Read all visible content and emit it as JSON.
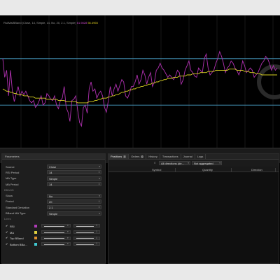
{
  "chart": {
    "indicator_title": "Rsi/Ma/BBand (Close, 14, Simple, 14, No, 20, 2.1, Simple)",
    "indicator_value_1": "61.9828",
    "indicator_value_2": "56.4965",
    "series": [
      {
        "name": "RSI",
        "color": "#b030b0"
      },
      {
        "name": "MA",
        "color": "#d8d020"
      }
    ],
    "ylim": [
      0,
      100
    ],
    "overbought_level": 70,
    "oversold_level": 30,
    "rsi_values": [
      70,
      54,
      60,
      38,
      60,
      42,
      33,
      40,
      46,
      38,
      42,
      39,
      42,
      38,
      34,
      32,
      34,
      28,
      30,
      34,
      38,
      30,
      32,
      40,
      38,
      35,
      34,
      38,
      30,
      27,
      34,
      36,
      46,
      28,
      24,
      16,
      34,
      35,
      38,
      26,
      15,
      12,
      28,
      30,
      23,
      44,
      50,
      42,
      44,
      36,
      40,
      42,
      38,
      28,
      24,
      34,
      46,
      38,
      44,
      48,
      42,
      47,
      52,
      50,
      38,
      36,
      40,
      46,
      46,
      50,
      56,
      48,
      52,
      60,
      56,
      48,
      54,
      58,
      46,
      50,
      60,
      62,
      66,
      62,
      60,
      57,
      54,
      56,
      54,
      52,
      55,
      60,
      58,
      48,
      52,
      60,
      64,
      68,
      60,
      58,
      55,
      54,
      62,
      60,
      58,
      70,
      74,
      62,
      56,
      58,
      60,
      66,
      70,
      76,
      72,
      66,
      58,
      62,
      64,
      68,
      66,
      62,
      60,
      56,
      60,
      68,
      64,
      58,
      60,
      62,
      60,
      54,
      56,
      58,
      62,
      66,
      68,
      72,
      70,
      66,
      60,
      64,
      60,
      62
    ],
    "ma_values": [
      44,
      43,
      42,
      42,
      41,
      41,
      40,
      40,
      39,
      39,
      39,
      38,
      38,
      38,
      37,
      37,
      37,
      36,
      36,
      36,
      36,
      36,
      36,
      35,
      35,
      35,
      35,
      35,
      35,
      34,
      34,
      34,
      34,
      33,
      33,
      33,
      33,
      33,
      33,
      32,
      32,
      32,
      32,
      32,
      32,
      33,
      33,
      33,
      34,
      34,
      35,
      35,
      36,
      36,
      36,
      37,
      37,
      38,
      38,
      39,
      39,
      40,
      41,
      41,
      42,
      42,
      43,
      43,
      44,
      44,
      45,
      45,
      46,
      46,
      47,
      47,
      48,
      48,
      49,
      49,
      50,
      50,
      51,
      51,
      52,
      52,
      53,
      53,
      53,
      54,
      54,
      54,
      55,
      55,
      55,
      55,
      56,
      56,
      56,
      57,
      57,
      57,
      57,
      58,
      58,
      58,
      58,
      59,
      59,
      59,
      59,
      60,
      60,
      60,
      60,
      60,
      60,
      60,
      61,
      61,
      61,
      61,
      60,
      60,
      60,
      60,
      59,
      59,
      59,
      58,
      58,
      58,
      57,
      57,
      57,
      56,
      56,
      56,
      56,
      56,
      56,
      56,
      56,
      56
    ]
  },
  "parameters_panel": {
    "title": "Parameters",
    "rows": [
      {
        "label": "Source",
        "value": "Close"
      },
      {
        "label": "RSI Period",
        "value": "14"
      },
      {
        "label": "MA Type",
        "value": "Simple"
      },
      {
        "label": "MA Period",
        "value": "14"
      }
    ],
    "bband_section_label": "BBAND",
    "bband_rows": [
      {
        "label": "Show",
        "value": "No"
      },
      {
        "label": "Period",
        "value": "20"
      },
      {
        "label": "Standard Deviation",
        "value": "2.1"
      },
      {
        "label": "BBand MA Type",
        "value": "Simple"
      }
    ],
    "lines_section_label": "Lines",
    "lines": [
      {
        "label": "RSI",
        "color": "#b03cb8",
        "width_value": "1"
      },
      {
        "label": "MA",
        "color": "#e0d040",
        "width_value": "1"
      },
      {
        "label": "Top BBand",
        "color": "#e09030",
        "width_value": "1"
      },
      {
        "label": "Bottom BBa...",
        "color": "#40c8d0",
        "width_value": "1"
      }
    ]
  },
  "positions_panel": {
    "tabs": [
      {
        "label": "Positions",
        "badge": "0",
        "active": true
      },
      {
        "label": "Orders",
        "badge": "0",
        "active": false
      },
      {
        "label": "History",
        "badge": "",
        "active": false
      },
      {
        "label": "Transactions",
        "badge": "",
        "active": false
      },
      {
        "label": "Journal",
        "badge": "",
        "active": false
      },
      {
        "label": "Logs",
        "badge": "",
        "active": false
      }
    ],
    "direction_filter": "All directions (de...",
    "aggregation_filter": "Not aggregated",
    "columns": [
      "Symbol",
      "Quantity",
      "Direction"
    ]
  }
}
